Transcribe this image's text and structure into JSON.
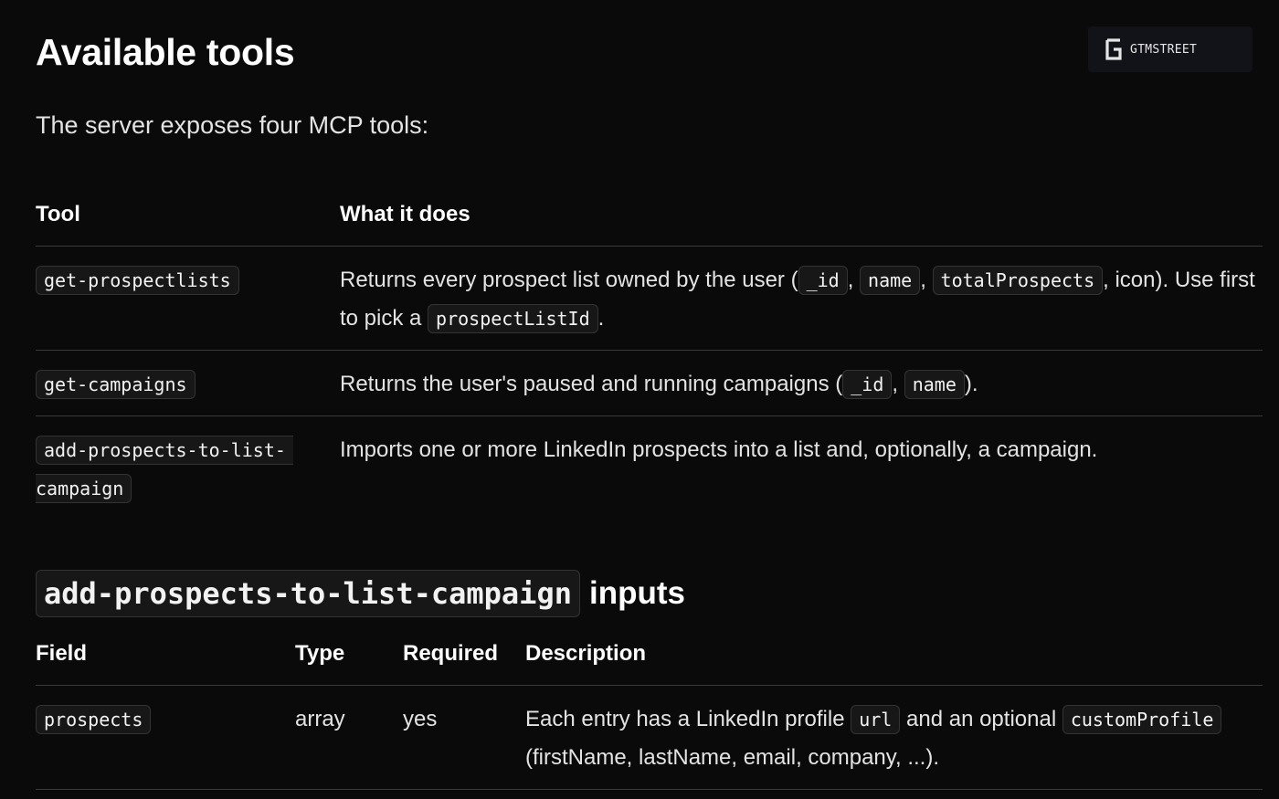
{
  "section": {
    "title": "Available tools",
    "intro": "The server exposes four MCP tools:"
  },
  "logo": {
    "text": "GTMSTREET"
  },
  "tools_table": {
    "headers": {
      "tool": "Tool",
      "what": "What it does"
    },
    "rows": [
      {
        "tool": "get-prospectlists",
        "desc": {
          "t1": "Returns every prospect list owned by the user (",
          "c1": "_id",
          "s1": ", ",
          "c2": "name",
          "s2": ", ",
          "c3": "totalProspects",
          "t2": ", icon). Use first to pick a ",
          "c4": "prospectListId",
          "t3": "."
        }
      },
      {
        "tool": "get-campaigns",
        "desc": {
          "t1": "Returns the user's paused and running campaigns (",
          "c1": "_id",
          "s1": ", ",
          "c2": "name",
          "t2": ")."
        }
      },
      {
        "tool_line1": "add-prospects-to-list-",
        "tool_line2": "campaign",
        "desc": {
          "t1": "Imports one or more LinkedIn prospects into a list and, optionally, a campaign."
        }
      }
    ]
  },
  "inputs_section": {
    "code": "add-prospects-to-list-campaign",
    "word": "inputs",
    "headers": {
      "field": "Field",
      "type": "Type",
      "required": "Required",
      "description": "Description"
    },
    "rows": [
      {
        "field": "prospects",
        "type": "array",
        "required": "yes",
        "desc": {
          "t1": "Each entry has a LinkedIn profile ",
          "c1": "url",
          "t2": " and an optional ",
          "c2": "customProfile",
          "t3": "(firstName, lastName, email, company, ...)."
        }
      }
    ]
  }
}
